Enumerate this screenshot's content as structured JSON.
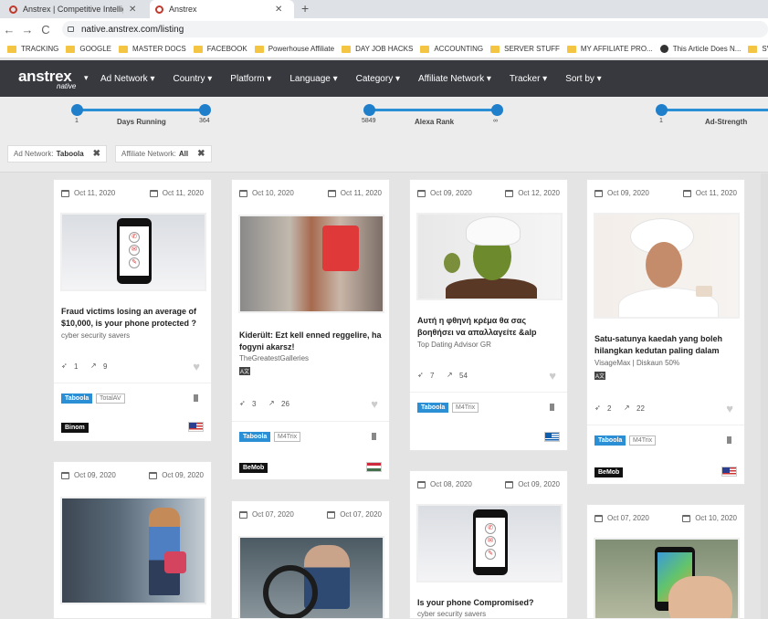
{
  "browser": {
    "tabs": [
      {
        "title": "Anstrex | Competitive Intelligence",
        "close": "✕"
      },
      {
        "title": "Anstrex",
        "close": "✕"
      }
    ],
    "new_tab": "+",
    "back": "←",
    "forward": "→",
    "reload": "C",
    "url": "native.anstrex.com/listing",
    "bookmarks": [
      {
        "label": "TRACKING",
        "icon": "folder"
      },
      {
        "label": "GOOGLE",
        "icon": "folder"
      },
      {
        "label": "MASTER DOCS",
        "icon": "folder"
      },
      {
        "label": "FACEBOOK",
        "icon": "folder"
      },
      {
        "label": "Powerhouse Affiliate",
        "icon": "folder"
      },
      {
        "label": "DAY JOB HACKS",
        "icon": "folder"
      },
      {
        "label": "ACCOUNTING",
        "icon": "folder"
      },
      {
        "label": "SERVER STUFF",
        "icon": "folder"
      },
      {
        "label": "MY AFFILIATE PRO...",
        "icon": "folder"
      },
      {
        "label": "This Article Does N...",
        "icon": "github"
      },
      {
        "label": "SV",
        "icon": "folder"
      }
    ]
  },
  "header": {
    "brand": "anstrex",
    "brand_sub": "native",
    "brand_caret": "▾",
    "menu": [
      "Ad Network ▾",
      "Country ▾",
      "Platform ▾",
      "Language ▾",
      "Category ▾",
      "Affiliate Network ▾",
      "Tracker ▾",
      "Sort by ▾"
    ]
  },
  "filters": {
    "sliders": [
      {
        "name": "Days Running",
        "min": "1",
        "max": "364"
      },
      {
        "name": "Alexa Rank",
        "min": "5849",
        "max": "∞"
      },
      {
        "name": "Ad-Strength",
        "min": "1",
        "max": ""
      }
    ],
    "chips": [
      {
        "label": "Ad Network:",
        "value": "Taboola",
        "close": "✖"
      },
      {
        "label": "Affiliate Network:",
        "value": "All",
        "close": "✖"
      }
    ]
  },
  "cards": [
    {
      "first_seen": "Oct 11, 2020",
      "last_seen": "Oct 11, 2020",
      "image": "phone-icon",
      "title": "Fraud victims losing an average of $10,000, is your phone protected ?",
      "source": "cyber security savers",
      "lang": "",
      "days": "1",
      "trend": "9",
      "network": "Taboola",
      "affiliate": "TotalAV",
      "tracker": "Binom",
      "country": "US",
      "heart": "♥"
    },
    {
      "first_seen": "Oct 10, 2020",
      "last_seen": "Oct 11, 2020",
      "image": "fitness-photo",
      "title": "Kiderült: Ezt kell enned reggelire, ha fogyni akarsz!",
      "source": "TheGreatestGalleries",
      "lang": "A文",
      "days": "3",
      "trend": "26",
      "network": "Taboola",
      "affiliate": "M4Trix",
      "tracker": "BeMob",
      "country": "HU",
      "heart": "♥"
    },
    {
      "first_seen": "Oct 09, 2020",
      "last_seen": "Oct 12, 2020",
      "image": "face-mask-photo",
      "title": "Αυτή η φθηνή κρέμα θα σας βοηθήσει να απαλλαγείτε &alp",
      "source": "Top Dating Advisor GR",
      "lang": "",
      "days": "7",
      "trend": "54",
      "network": "Taboola",
      "affiliate": "M4Trix",
      "tracker": "",
      "country": "GR",
      "heart": "♥"
    },
    {
      "first_seen": "Oct 09, 2020",
      "last_seen": "Oct 11, 2020",
      "image": "skincare-photo",
      "title": "Satu-satunya kaedah yang boleh hilangkan kedutan paling dalam",
      "source": "VisageMax | Diskaun 50%",
      "lang": "A文",
      "days": "2",
      "trend": "22",
      "network": "Taboola",
      "affiliate": "M4Trix",
      "tracker": "BeMob",
      "country": "US",
      "heart": "♥"
    },
    {
      "first_seen": "Oct 09, 2020",
      "last_seen": "Oct 09, 2020",
      "image": "car-photo"
    },
    {
      "first_seen": "Oct 07, 2020",
      "last_seen": "Oct 07, 2020",
      "image": "driving-photo"
    },
    {
      "first_seen": "Oct 08, 2020",
      "last_seen": "Oct 09, 2020",
      "image": "phone-icon",
      "title": "Is your phone Compromised?",
      "source": "cyber security savers"
    },
    {
      "first_seen": "Oct 07, 2020",
      "last_seen": "Oct 10, 2020",
      "image": "smartphone-hand-photo"
    }
  ],
  "colors": {
    "header_bg": "#37393f",
    "accent": "#2b8fd6",
    "page_bg": "#e4e4e4"
  }
}
